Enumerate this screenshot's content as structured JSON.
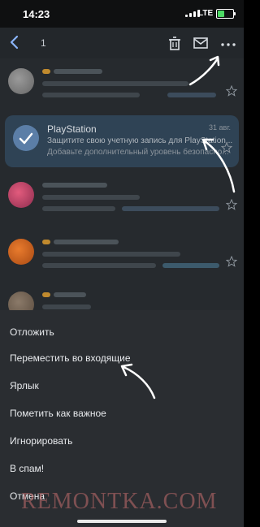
{
  "status": {
    "time": "14:23",
    "network": "LTE"
  },
  "toolbar": {
    "selected_count": "1"
  },
  "selected_email": {
    "sender": "PlayStation",
    "date": "31 авг.",
    "subject": "Защитите свою учетную запись для PlayStation...",
    "preview": "Добавьте дополнительный уровень безопасно..."
  },
  "sheet": {
    "items": [
      "Отложить",
      "Переместить во входящие",
      "Ярлык",
      "Пометить как важное",
      "Игнорировать",
      "В спам!",
      "Отмена"
    ]
  },
  "watermark": "REMONTKA.COM",
  "colors": {
    "accent": "#5b7ea7",
    "selected_bg": "#2f4355",
    "sheet_bg": "#2a2d31"
  }
}
